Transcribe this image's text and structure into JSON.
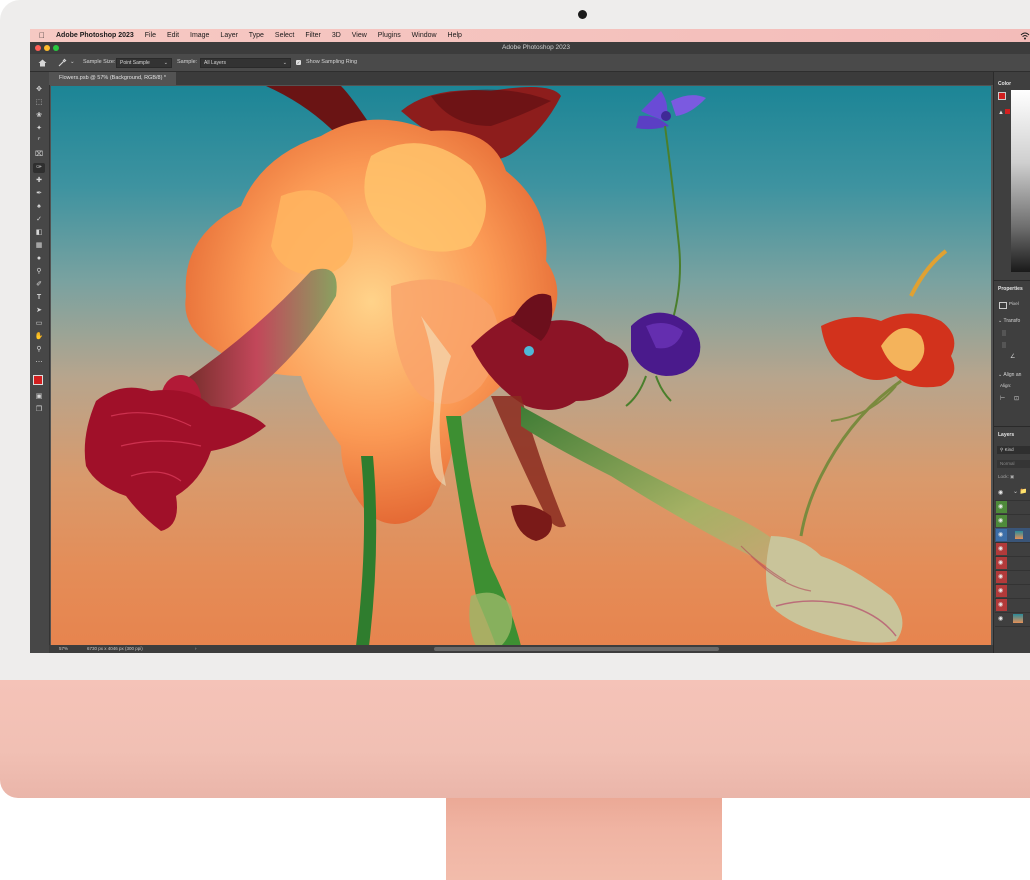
{
  "menubar": {
    "app_name": "Adobe Photoshop 2023",
    "items": [
      "File",
      "Edit",
      "Image",
      "Layer",
      "Type",
      "Select",
      "Filter",
      "3D",
      "View",
      "Plugins",
      "Window",
      "Help"
    ]
  },
  "window": {
    "title": "Adobe Photoshop 2023"
  },
  "options_bar": {
    "sample_size_label": "Sample Size:",
    "sample_size_value": "Point Sample",
    "sample_label": "Sample:",
    "sample_value": "All Layers",
    "show_sampling_ring": "Show Sampling Ring"
  },
  "document_tab": {
    "label": "Flowers.psb @ 57% (Background, RGB/8) *"
  },
  "status_bar": {
    "zoom": "57%",
    "doc_info": "6730 px x 4046 px (300 ppi)"
  },
  "right_panel": {
    "color_tab": "Color",
    "properties_tab": "Properties",
    "transform_label": "Transfo",
    "align_label": "Align an",
    "align_sub": "Align:",
    "pixel_label": "Pixel",
    "layers_tab": "Layers",
    "kind_label": "Kind",
    "blend_mode": "Normal",
    "lock_label": "Lock:"
  },
  "colors": {
    "foreground": "#d21f1f",
    "background": "#1c2f8c",
    "chassis_pink": "#f2c0b4",
    "menubar_pink": "#f5c5c0"
  },
  "layers": [
    {
      "tag": "green"
    },
    {
      "tag": "green"
    },
    {
      "tag": "blue"
    },
    {
      "tag": "red"
    },
    {
      "tag": "red"
    },
    {
      "tag": "red"
    },
    {
      "tag": "red"
    },
    {
      "tag": "red"
    },
    {
      "tag": "none"
    }
  ]
}
